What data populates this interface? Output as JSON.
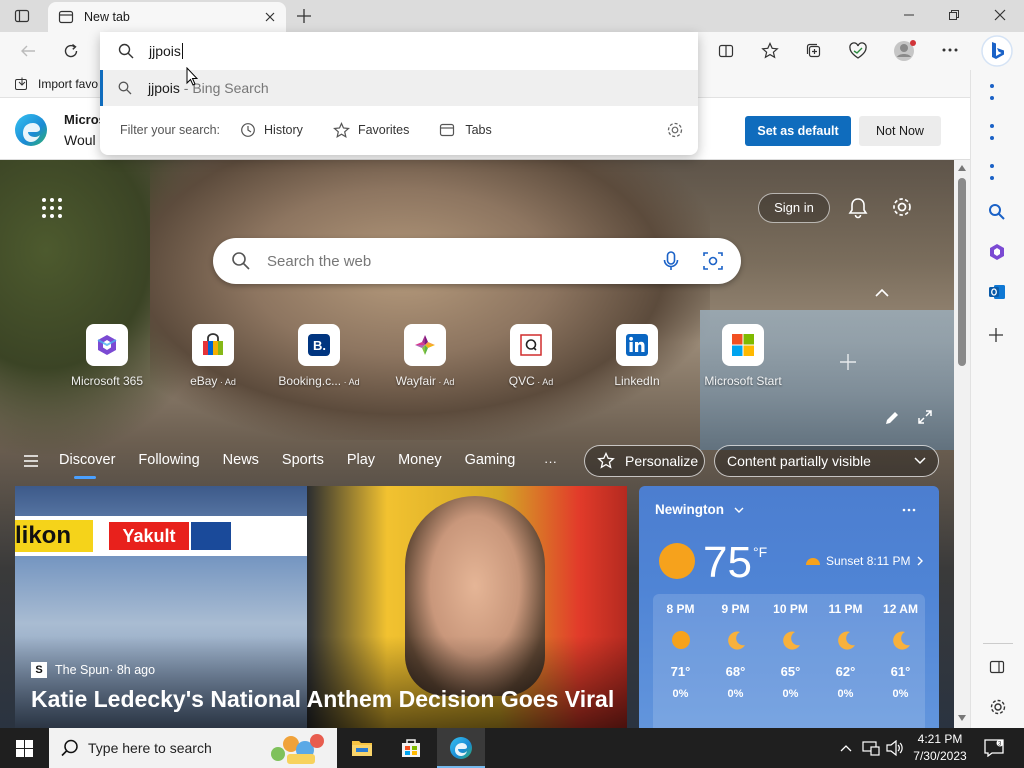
{
  "tab": {
    "title": "New tab"
  },
  "address": {
    "value": "jjpois"
  },
  "suggestion": {
    "query": "jjpois",
    "suffix": " - Bing Search"
  },
  "filter": {
    "label": "Filter your search:",
    "history": "History",
    "favorites": "Favorites",
    "tabs": "Tabs"
  },
  "favbar": {
    "import": "Import favo"
  },
  "notif": {
    "title": "Micros",
    "body": "Woul",
    "set_default": "Set as default",
    "not_now": "Not Now"
  },
  "page": {
    "sign_in": "Sign in",
    "search_placeholder": "Search the web",
    "quicklinks": [
      {
        "label": "Microsoft 365",
        "ad": ""
      },
      {
        "label": "eBay",
        "ad": " · Ad"
      },
      {
        "label": "Booking.c...",
        "ad": " · Ad"
      },
      {
        "label": "Wayfair",
        "ad": " · Ad"
      },
      {
        "label": "QVC",
        "ad": " · Ad"
      },
      {
        "label": "LinkedIn",
        "ad": ""
      },
      {
        "label": "Microsoft Start",
        "ad": ""
      }
    ],
    "nav": [
      "Discover",
      "Following",
      "News",
      "Sports",
      "Play",
      "Money",
      "Gaming"
    ],
    "more": "···",
    "personalize": "Personalize",
    "content_visible": "Content partially visible"
  },
  "news": {
    "source": "The Spun",
    "age": " · 8h ago",
    "headline": "Katie Ledecky's National Anthem Decision Goes Viral",
    "banner_left": "likon",
    "banner_mid": "Yakult"
  },
  "weather": {
    "location": "Newington",
    "temp": "75",
    "unit": "°F",
    "sunset": "Sunset 8:11 PM",
    "hours": [
      {
        "time": "8 PM",
        "temp": "71°",
        "precip": "0%",
        "icon": "sun"
      },
      {
        "time": "9 PM",
        "temp": "68°",
        "precip": "0%",
        "icon": "moon"
      },
      {
        "time": "10 PM",
        "temp": "65°",
        "precip": "0%",
        "icon": "moon"
      },
      {
        "time": "11 PM",
        "temp": "62°",
        "precip": "0%",
        "icon": "moon"
      },
      {
        "time": "12 AM",
        "temp": "61°",
        "precip": "0%",
        "icon": "moon"
      }
    ]
  },
  "taskbar": {
    "search_placeholder": "Type here to search",
    "time": "4:21 PM",
    "date": "7/30/2023"
  },
  "colors": {
    "accent": "#0f6cbd",
    "sun": "#f6a21c",
    "taskbar": "#1f1f1f"
  }
}
